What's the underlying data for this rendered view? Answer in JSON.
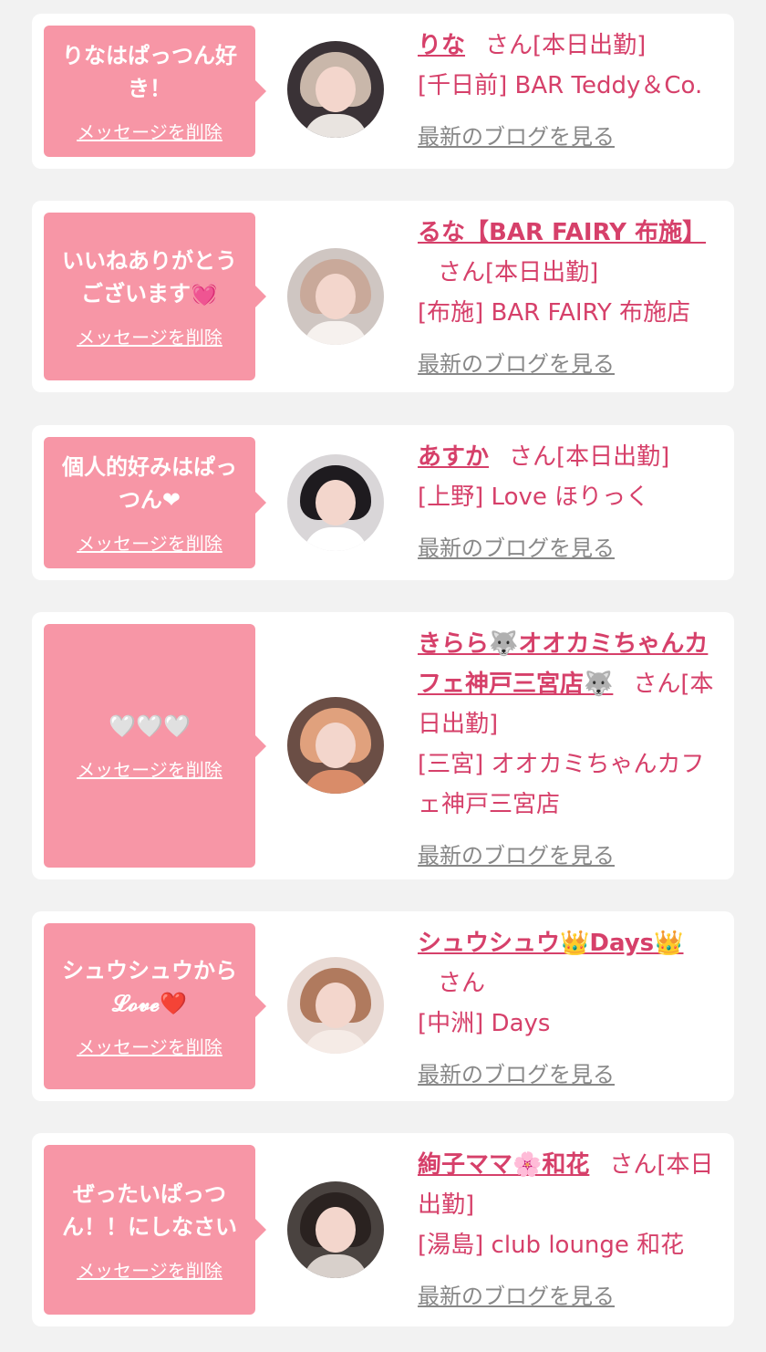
{
  "common": {
    "delete_label": "メッセージを削除",
    "blog_label": "最新のブログを見る"
  },
  "messages": [
    {
      "bubble": "りなはぱっつん好き！",
      "name": "りな",
      "san": "さん[本日出勤]",
      "shop": "[千日前] BAR Teddy＆Co."
    },
    {
      "bubble": "いいねありがとうございます💓",
      "name": "るな【BAR FAIRY 布施】",
      "san": "さん[本日出勤]",
      "shop": "[布施] BAR FAIRY 布施店"
    },
    {
      "bubble": "個人的好みはぱっつん❤",
      "name": "あすか",
      "san": "さん[本日出勤]",
      "shop": "[上野] Love ほりっく"
    },
    {
      "bubble": "🤍🤍🤍",
      "name": "きらら🐺オオカミちゃんカフェ神戸三宮店🐺",
      "san": "さん[本日出勤]",
      "shop": "[三宮] オオカミちゃんカフェ神戸三宮店"
    },
    {
      "bubble": "シュウシュウから𝓛𝓸𝓿𝓮❤️",
      "name": "シュウシュウ👑Days👑",
      "san": "さん",
      "shop": "[中洲] Days"
    },
    {
      "bubble": "ぜったいぱっつん！！にしなさい",
      "name": "絢子ママ🌸和花",
      "san": "さん[本日出勤]",
      "shop": "[湯島] club lounge 和花"
    }
  ],
  "colors": {
    "accent": "#d6406a",
    "bubble": "#f796a6",
    "link_gray": "#888888",
    "background": "#f2f2f2"
  }
}
